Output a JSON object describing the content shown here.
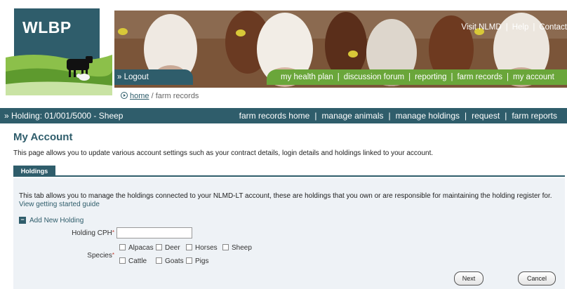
{
  "brand": {
    "logo_text": "WLBP"
  },
  "top_links": [
    "Visit NLMD",
    "Help",
    "Contact"
  ],
  "logout_label": "» Logout",
  "main_nav": [
    "my health plan",
    "discussion forum",
    "reporting",
    "farm records",
    "my account"
  ],
  "breadcrumb": {
    "home": "home",
    "current": " / farm records"
  },
  "holding_bar": {
    "holding": "» Holding: 01/001/5000 - Sheep",
    "links": [
      "farm records home",
      "manage animals",
      "manage holdings",
      "request",
      "farm reports"
    ]
  },
  "page": {
    "title": "My Account",
    "intro": "This page allows you to update various account settings such as your contract details, login details and holdings linked to your account."
  },
  "tabs": [
    {
      "label": "Holdings",
      "active": true
    }
  ],
  "holdings_panel": {
    "description": "This tab allows you to manage the holdings connected to your NLMD-LT account, these are holdings that you own or are responsible for maintaining the holding register for.",
    "guide_link": "View getting started guide",
    "add_section_label": "Add New Holding",
    "cph_label": "Holding CPH",
    "cph_value": "",
    "species_label": "Species",
    "species_row1": [
      "Alpacas",
      "Deer",
      "Horses",
      "Sheep"
    ],
    "species_row2": [
      "Cattle",
      "Goats",
      "Pigs"
    ],
    "next_label": "Next",
    "cancel_label": "Cancel"
  },
  "colors": {
    "primary": "#2f5d6b",
    "accent_green": "#6aa63a",
    "panel_bg": "#eef2f6"
  }
}
